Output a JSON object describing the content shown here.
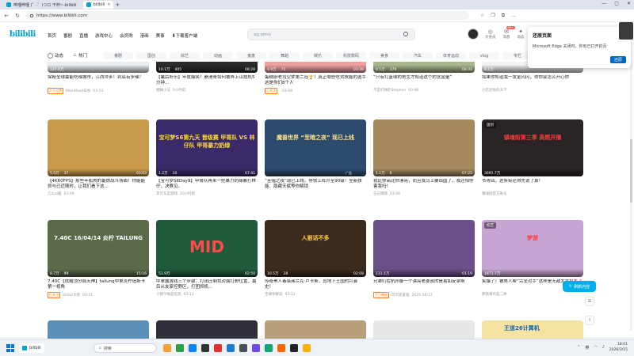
{
  "browser": {
    "tab_left_label": "哔哩哔哩 (゜-゜)つロ 干杯~-bilibili",
    "tab_active_label": "bilibili",
    "url": "https://www.bilibili.com",
    "colors": {
      "accent": "#00a1d6"
    }
  },
  "header": {
    "logo": "bilibili",
    "nav": [
      "首页",
      "番剧",
      "直播",
      "游戏中心",
      "会员购",
      "漫画",
      "赛事",
      "下载客户端"
    ],
    "search_placeholder": "aq wmo",
    "icons": [
      {
        "label": "大会员",
        "icon": "vip-icon"
      },
      {
        "label": "消息",
        "icon": "message-icon",
        "badge": "99+"
      },
      {
        "label": "动态",
        "icon": "dynamic-icon"
      }
    ]
  },
  "categories": {
    "fixed": [
      "动态",
      "热门"
    ],
    "items": [
      "番剧",
      "国创",
      "综艺",
      "动画",
      "鬼畜",
      "舞蹈",
      "娱乐",
      "科技数码",
      "美食",
      "汽车",
      "体育运动",
      "vlog",
      "专栏"
    ]
  },
  "cards": [
    {
      "views": "137.6万",
      "danmaku": "",
      "duration": "",
      "title": "探秘全球最能吃辣城市，江西萍乡！到底有多辣？",
      "up": "Mandfood日食",
      "date": "03-13",
      "mark": "千万点赞"
    },
    {
      "views": "10.1万",
      "danmaku": "405",
      "duration": "08:28",
      "title": "【襄后补乐】年度爆笑！崩溃哥如何被弄上山挂机5分钟…",
      "up": "模糊小号",
      "date": "9小时前",
      "mark": ""
    },
    {
      "views": "4.9万",
      "danmaku": "75",
      "duration": "03:36",
      "title": "蛋糕厨老司空梦第二冠🏆！真正哪些吃货技能的选手这是你们8个人",
      "up": "",
      "date": "03-08",
      "mark": "已关注"
    },
    {
      "views": "6.5万",
      "danmaku": "379",
      "duration": "08:31",
      "title": "“只有打篮球的男生才知道这个的含金量”",
      "up": "不是打球的Stephen",
      "date": "03-06",
      "mark": ""
    },
    {
      "views": "8.1万",
      "danmaku": "",
      "duration": "",
      "title": "如果你知道我一发金闪闪，你你会怎么开心你",
      "up": "小店老板的天下",
      "date": "",
      "mark": ""
    },
    {
      "views": "5.5万",
      "danmaku": "37",
      "duration": "03:03",
      "title": "【4K60FPS】那些年肌肉的最燃战斗场面！你能能抓与已近随时，让我们看下这…",
      "up": "几么ai酱",
      "date": "03-09",
      "mark": ""
    },
    {
      "views": "1.2万",
      "danmaku": "10",
      "duration": "07:41",
      "title": "【宝可梦S6Day9】甲哥队再来一把暴力奶绿暴打林仔，决赛见。",
      "up": "李可东是游戏",
      "date": "20小时前",
      "mark": ""
    },
    {
      "views": "",
      "danmaku": "",
      "duration": "",
      "title": "“至暗之夜”现已上线，停领上阵开至90级！全新技能、隐藏天赋等你解锁",
      "up": "",
      "date": "",
      "mark": ""
    },
    {
      "views": "1.1万",
      "danmaku": "6",
      "duration": "07:25",
      "title": "我比你高比你漂亮，而且我马上要出国了，我还怕你害我吗！",
      "up": "忘记蹲蹲",
      "date": "03-06",
      "mark": ""
    },
    {
      "views": "3691.7万",
      "danmaku": "",
      "duration": "",
      "title": "爷青回，这条街还得先说了算！",
      "up": "镇魂街官方账号",
      "date": "",
      "mark": ""
    },
    {
      "views": "8.7万",
      "danmaku": "99",
      "duration": "15:16",
      "title": "7.40C【炫耀顶分局天神】tailung中单炎柠追斯卡 第一视角",
      "up": "dota2大佬",
      "date": "03-11",
      "mark": "已关注"
    },
    {
      "views": "51.9万",
      "danmaku": "",
      "duration": "02:50",
      "title": "中单露游戏三个步骤：打出压制找对面打野位置，最后从友家控野区，打团抓机…",
      "up": "小猪午睡是吃饭",
      "date": "03-13",
      "mark": ""
    },
    {
      "views": "10.5万",
      "danmaku": "28",
      "duration": "02:08",
      "title": "传奇黑人毒枭弗兰克·卢卡斯，其地下王国的兴衰史！",
      "up": "无罪体解说",
      "date": "03-12",
      "mark": ""
    },
    {
      "views": "131.1万",
      "danmaku": "",
      "duration": "01:19",
      "title": "兄弟们在杭州娶一个漂亮老婆真的是易如反掌啊",
      "up": "可可爱爱喵",
      "date": "2025-10-17",
      "mark": "百万播放"
    },
    {
      "views": "1873.7万",
      "danmaku": "",
      "duration": "",
      "title": "笑爆了！被男人帮“完全对手”这样是无敌太太搞笑了",
      "up": "那我真的是二季",
      "date": "",
      "mark": ""
    }
  ],
  "thumb_art": [
    {
      "bg": "#e8eef2",
      "text": "",
      "color": "#ffffff"
    },
    {
      "bg": "#2b2b2b",
      "text": "",
      "color": "#ffffff"
    },
    {
      "bg": "#f0a0a0",
      "text": "",
      "color": "#ffffff"
    },
    {
      "bg": "#a9b88c",
      "text": "",
      "color": "#ffffff"
    },
    {
      "bg": "#f2f2f2",
      "text": "",
      "color": "#ffffff"
    },
    {
      "bg": "#c99a4a",
      "text": "",
      "color": "#ffffff"
    },
    {
      "bg": "#3a2a6a",
      "text": "宝可梦S6第九天 晋级赛 甲哥队 VS 林仔队 甲哥暴力奶绿",
      "color": "#ffdd33"
    },
    {
      "bg": "#2c4b6e",
      "text": "魔兽世界 “至暗之夜” 现已上线",
      "color": "#ffe28a"
    },
    {
      "bg": "#a48a5e",
      "text": "",
      "color": "#ffffff"
    },
    {
      "bg": "#2a2424",
      "text": "镇魂街第三季 高燃开播",
      "color": "#ff3b3b"
    },
    {
      "bg": "#5b6b4a",
      "text": "7.40C 16/04/14 炎柠 TAILUNG",
      "color": "#ffffff"
    },
    {
      "bg": "#1f5a3a",
      "text": "MID",
      "color": "#ff4a4a"
    },
    {
      "bg": "#3b2a1e",
      "text": "人狠话不多",
      "color": "#ffcc33"
    },
    {
      "bg": "#6a4f8a",
      "text": "",
      "color": "#ffffff"
    },
    {
      "bg": "#c7a5d2",
      "text": "梦游",
      "color": "#ff3b3b"
    }
  ],
  "card_tags": {
    "9": "国创",
    "14": "综艺"
  },
  "card_ad_label": "广告",
  "bottom_row": [
    "",
    "",
    "",
    "",
    "王道26计算机"
  ],
  "refresh_label": "刷新内容",
  "popup": {
    "title": "还原页面",
    "text": "Microsoft Edge 关闭时，你有已打开的页",
    "button": "还原"
  },
  "taskbar": {
    "app_label": "bilibili",
    "search_placeholder": "搜索",
    "tray_lang": "英",
    "time": "18:01",
    "date": "2026/3/15"
  }
}
